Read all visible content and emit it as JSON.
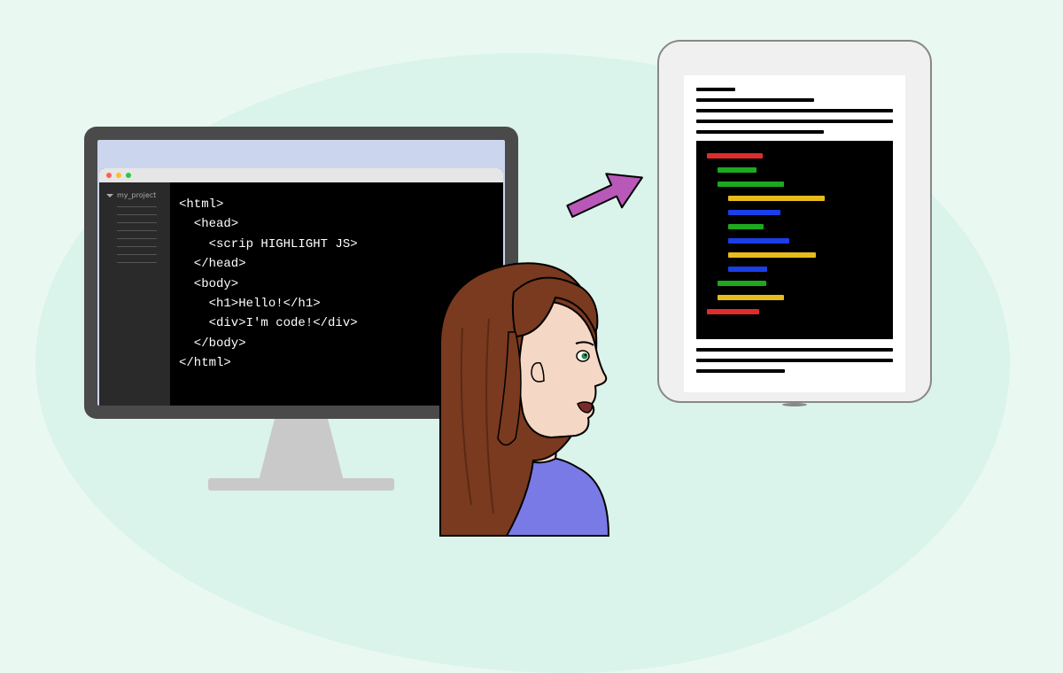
{
  "editor": {
    "sidebar": {
      "project_name": "my_project"
    },
    "code_lines": [
      "<html>",
      "  <head>",
      "    <scrip HIGHLIGHT JS>",
      "  </head>",
      "  <body>",
      "    <h1>Hello!</h1>",
      "    <div>I'm code!</div>",
      "  </body>",
      "</html>"
    ]
  },
  "tablet": {
    "code_colors": [
      "red",
      "green",
      "green",
      "yellow",
      "blue",
      "green",
      "blue",
      "yellow",
      "blue",
      "green",
      "yellow",
      "red"
    ]
  }
}
